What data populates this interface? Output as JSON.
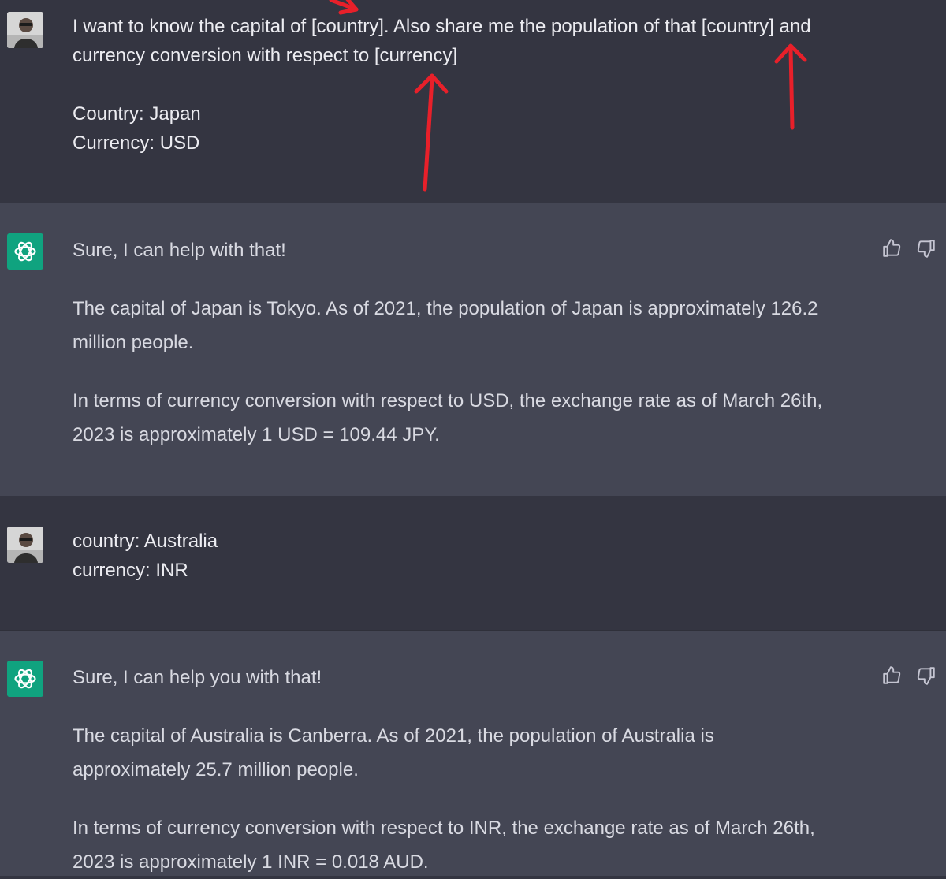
{
  "conversation": {
    "messages": [
      {
        "role": "user",
        "avatar_icon": "user-avatar-photo",
        "lines": [
          "I want to know the capital of [country]. Also share me the population of that [country] and",
          "currency conversion with respect to [currency]"
        ],
        "lines2": [
          "Country: Japan",
          "Currency: USD"
        ]
      },
      {
        "role": "assistant",
        "avatar_icon": "chatgpt-logo-icon",
        "paragraphs": [
          "Sure, I can help with that!",
          "The capital of Japan is Tokyo. As of 2021, the population of Japan is approximately 126.2 million people.",
          "In terms of currency conversion with respect to USD, the exchange rate as of March 26th, 2023 is approximately 1 USD = 109.44 JPY."
        ]
      },
      {
        "role": "user",
        "avatar_icon": "user-avatar-photo",
        "lines": [
          "country: Australia",
          "currency: INR"
        ]
      },
      {
        "role": "assistant",
        "avatar_icon": "chatgpt-logo-icon",
        "paragraphs": [
          "Sure, I can help you with that!",
          "The capital of Australia is Canberra. As of 2021, the population of Australia is approximately 25.7 million people.",
          "In terms of currency conversion with respect to INR, the exchange rate as of March 26th, 2023 is approximately 1 INR = 0.018 AUD."
        ]
      }
    ]
  },
  "feedback": {
    "icons": [
      "thumbs-up-icon",
      "thumbs-down-icon"
    ]
  },
  "annotation": {
    "arrow_color": "#e8202a"
  },
  "colors": {
    "user_bg": "#343541",
    "assistant_bg": "#444654",
    "bot_avatar_bg": "#10a37f",
    "text": "#ececf1"
  }
}
